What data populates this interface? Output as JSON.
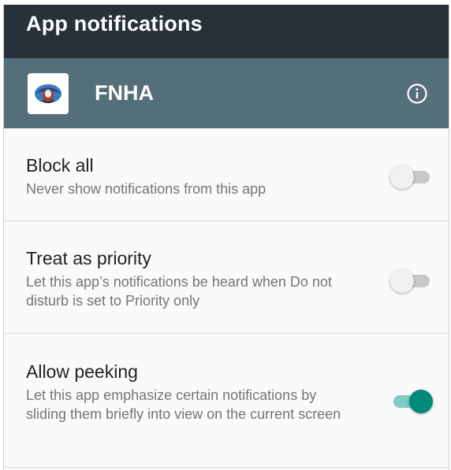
{
  "header": {
    "title": "App notifications"
  },
  "app": {
    "name": "FNHA",
    "icon": "fnha-logo-icon",
    "info_icon": "info-icon"
  },
  "settings": [
    {
      "label": "Block all",
      "description": "Never show notifications from this app",
      "enabled": false
    },
    {
      "label": "Treat as priority",
      "description": "Let this app’s notifications be heard when Do not disturb is set to Priority only",
      "enabled": false
    },
    {
      "label": "Allow peeking",
      "description": "Let this app emphasize certain notifications by sliding them briefly into view on the current screen",
      "enabled": true
    }
  ],
  "colors": {
    "title_bar": "#263238",
    "app_bar": "#546e7a",
    "accent": "#00897b",
    "accent_track": "#80cbc4"
  }
}
